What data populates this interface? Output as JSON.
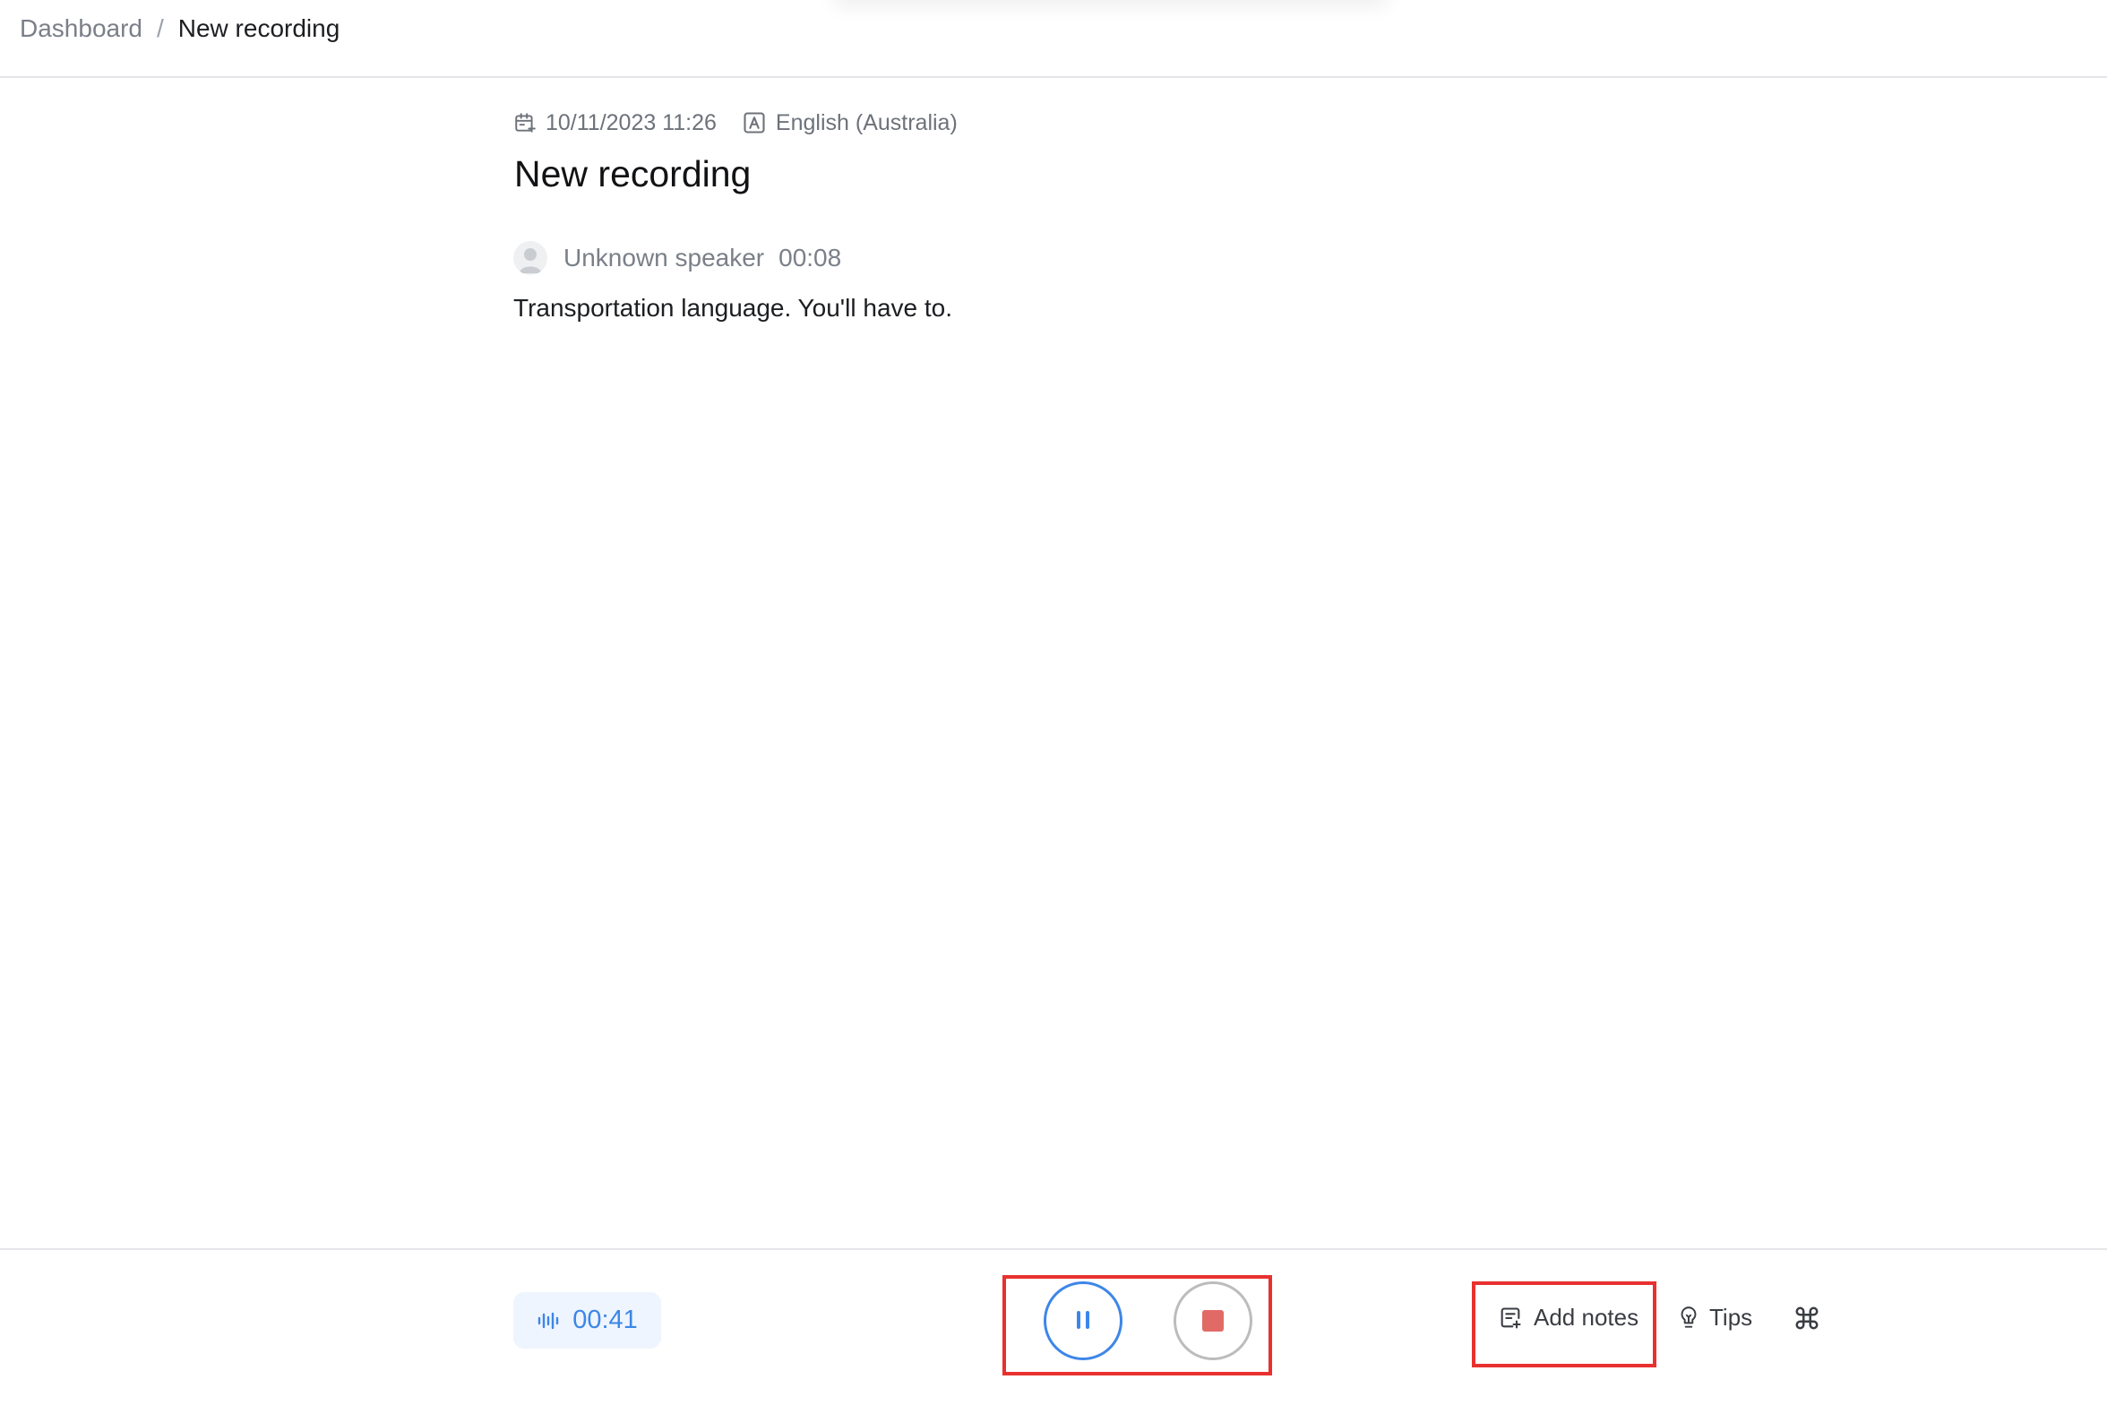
{
  "breadcrumb": {
    "parent": "Dashboard",
    "separator": "/",
    "current": "New recording"
  },
  "meta": {
    "datetime": "10/11/2023 11:26",
    "datetime_icon": "calendar-icon",
    "language": "English (Australia)",
    "language_icon": "language-icon"
  },
  "recording": {
    "title": "New recording"
  },
  "transcript": {
    "segments": [
      {
        "speaker": "Unknown speaker",
        "timestamp": "00:08",
        "text": "Transportation language. You'll have to."
      }
    ]
  },
  "footer": {
    "elapsed": "00:41",
    "elapsed_icon": "audio-wave-icon",
    "pause_icon": "pause-icon",
    "stop_icon": "stop-icon",
    "add_notes_label": "Add notes",
    "add_notes_icon": "note-add-icon",
    "tips_label": "Tips",
    "tips_icon": "lightbulb-icon",
    "shortcuts_icon": "command-icon"
  },
  "colors": {
    "accent": "#3d86e8",
    "stop": "#e26a66",
    "highlight": "#e8312f",
    "muted_text": "#7a7f88"
  }
}
